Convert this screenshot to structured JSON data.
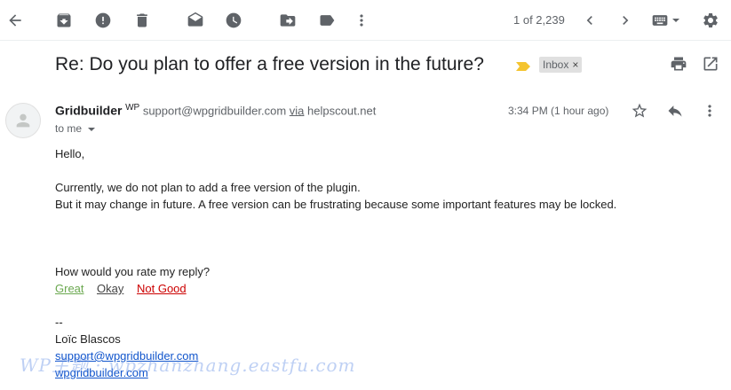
{
  "toolbar": {
    "icons": [
      "back-arrow-icon",
      "archive-icon",
      "report-spam-icon",
      "delete-icon",
      "mark-unread-icon",
      "snooze-icon",
      "move-to-icon",
      "label-icon",
      "more-vert-icon"
    ],
    "pager": "1 of 2,239",
    "right_icons": [
      "chevron-left-icon",
      "chevron-right-icon",
      "keyboard-icon",
      "settings-icon"
    ]
  },
  "thread": {
    "subject": "Re: Do you plan to offer a free version in the future?",
    "label": "Inbox",
    "label_remove": "×",
    "colors": {
      "importance_marker": "#f4c430"
    }
  },
  "message": {
    "sender_name": "Gridbuilder",
    "sender_badge": "WP",
    "sender_email": "support@wpgridbuilder.com",
    "via": "via",
    "via_host": "helpscout.net",
    "to": "to me",
    "time": "3:34 PM (1 hour ago)",
    "body": {
      "greeting": "Hello,",
      "line1": "Currently, we do not plan to add a free version of the plugin.",
      "line2": "But it may change in future. A free version can be frustrating because some important features may be locked.",
      "rate_prompt": "How would you rate my reply?",
      "rating": {
        "great": "Great",
        "okay": "Okay",
        "not_good": "Not Good",
        "colors": {
          "great": "#6aa84f",
          "okay": "#444444",
          "not_good": "#cc0000"
        }
      },
      "sig_dash": "--",
      "sig_name": "Loïc Blascos",
      "sig_email": "support@wpgridbuilder.com",
      "sig_site": "wpgridbuilder.com"
    }
  },
  "watermark": "WP主题 · wpzhanzhang.eastfu.com"
}
